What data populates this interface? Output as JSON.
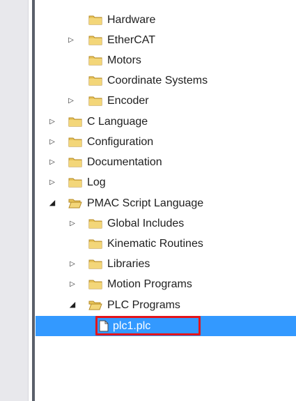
{
  "tree": {
    "items": [
      {
        "label": "Hardware",
        "icon": "folder-icon",
        "expander": "none",
        "level": 2
      },
      {
        "label": "EtherCAT",
        "icon": "folder-icon",
        "expander": "collapsed",
        "level": 2
      },
      {
        "label": "Motors",
        "icon": "folder-icon",
        "expander": "none",
        "level": 2
      },
      {
        "label": "Coordinate Systems",
        "icon": "folder-icon",
        "expander": "none",
        "level": 2
      },
      {
        "label": "Encoder",
        "icon": "folder-icon",
        "expander": "collapsed",
        "level": 2
      },
      {
        "label": "C Language",
        "icon": "folder-icon",
        "expander": "collapsed",
        "level": 1
      },
      {
        "label": "Configuration",
        "icon": "folder-icon",
        "expander": "collapsed",
        "level": 1
      },
      {
        "label": "Documentation",
        "icon": "folder-icon",
        "expander": "collapsed",
        "level": 1
      },
      {
        "label": "Log",
        "icon": "folder-icon",
        "expander": "collapsed",
        "level": 1
      },
      {
        "label": "PMAC Script Language",
        "icon": "folder-open-icon",
        "expander": "expanded",
        "level": 1
      },
      {
        "label": "Global Includes",
        "icon": "folder-icon",
        "expander": "collapsed",
        "level": 2
      },
      {
        "label": "Kinematic Routines",
        "icon": "folder-icon",
        "expander": "none",
        "level": 2
      },
      {
        "label": "Libraries",
        "icon": "folder-icon",
        "expander": "collapsed",
        "level": 2
      },
      {
        "label": "Motion Programs",
        "icon": "folder-icon",
        "expander": "collapsed",
        "level": 2
      },
      {
        "label": "PLC Programs",
        "icon": "folder-open-icon",
        "expander": "expanded",
        "level": 2
      },
      {
        "label": "plc1.plc",
        "icon": "file-icon",
        "expander": "none",
        "level": 3,
        "selected": true
      }
    ]
  },
  "colors": {
    "selection": "#3399ff",
    "highlight_box": "#e3141a",
    "folder": "#e8c45a"
  }
}
